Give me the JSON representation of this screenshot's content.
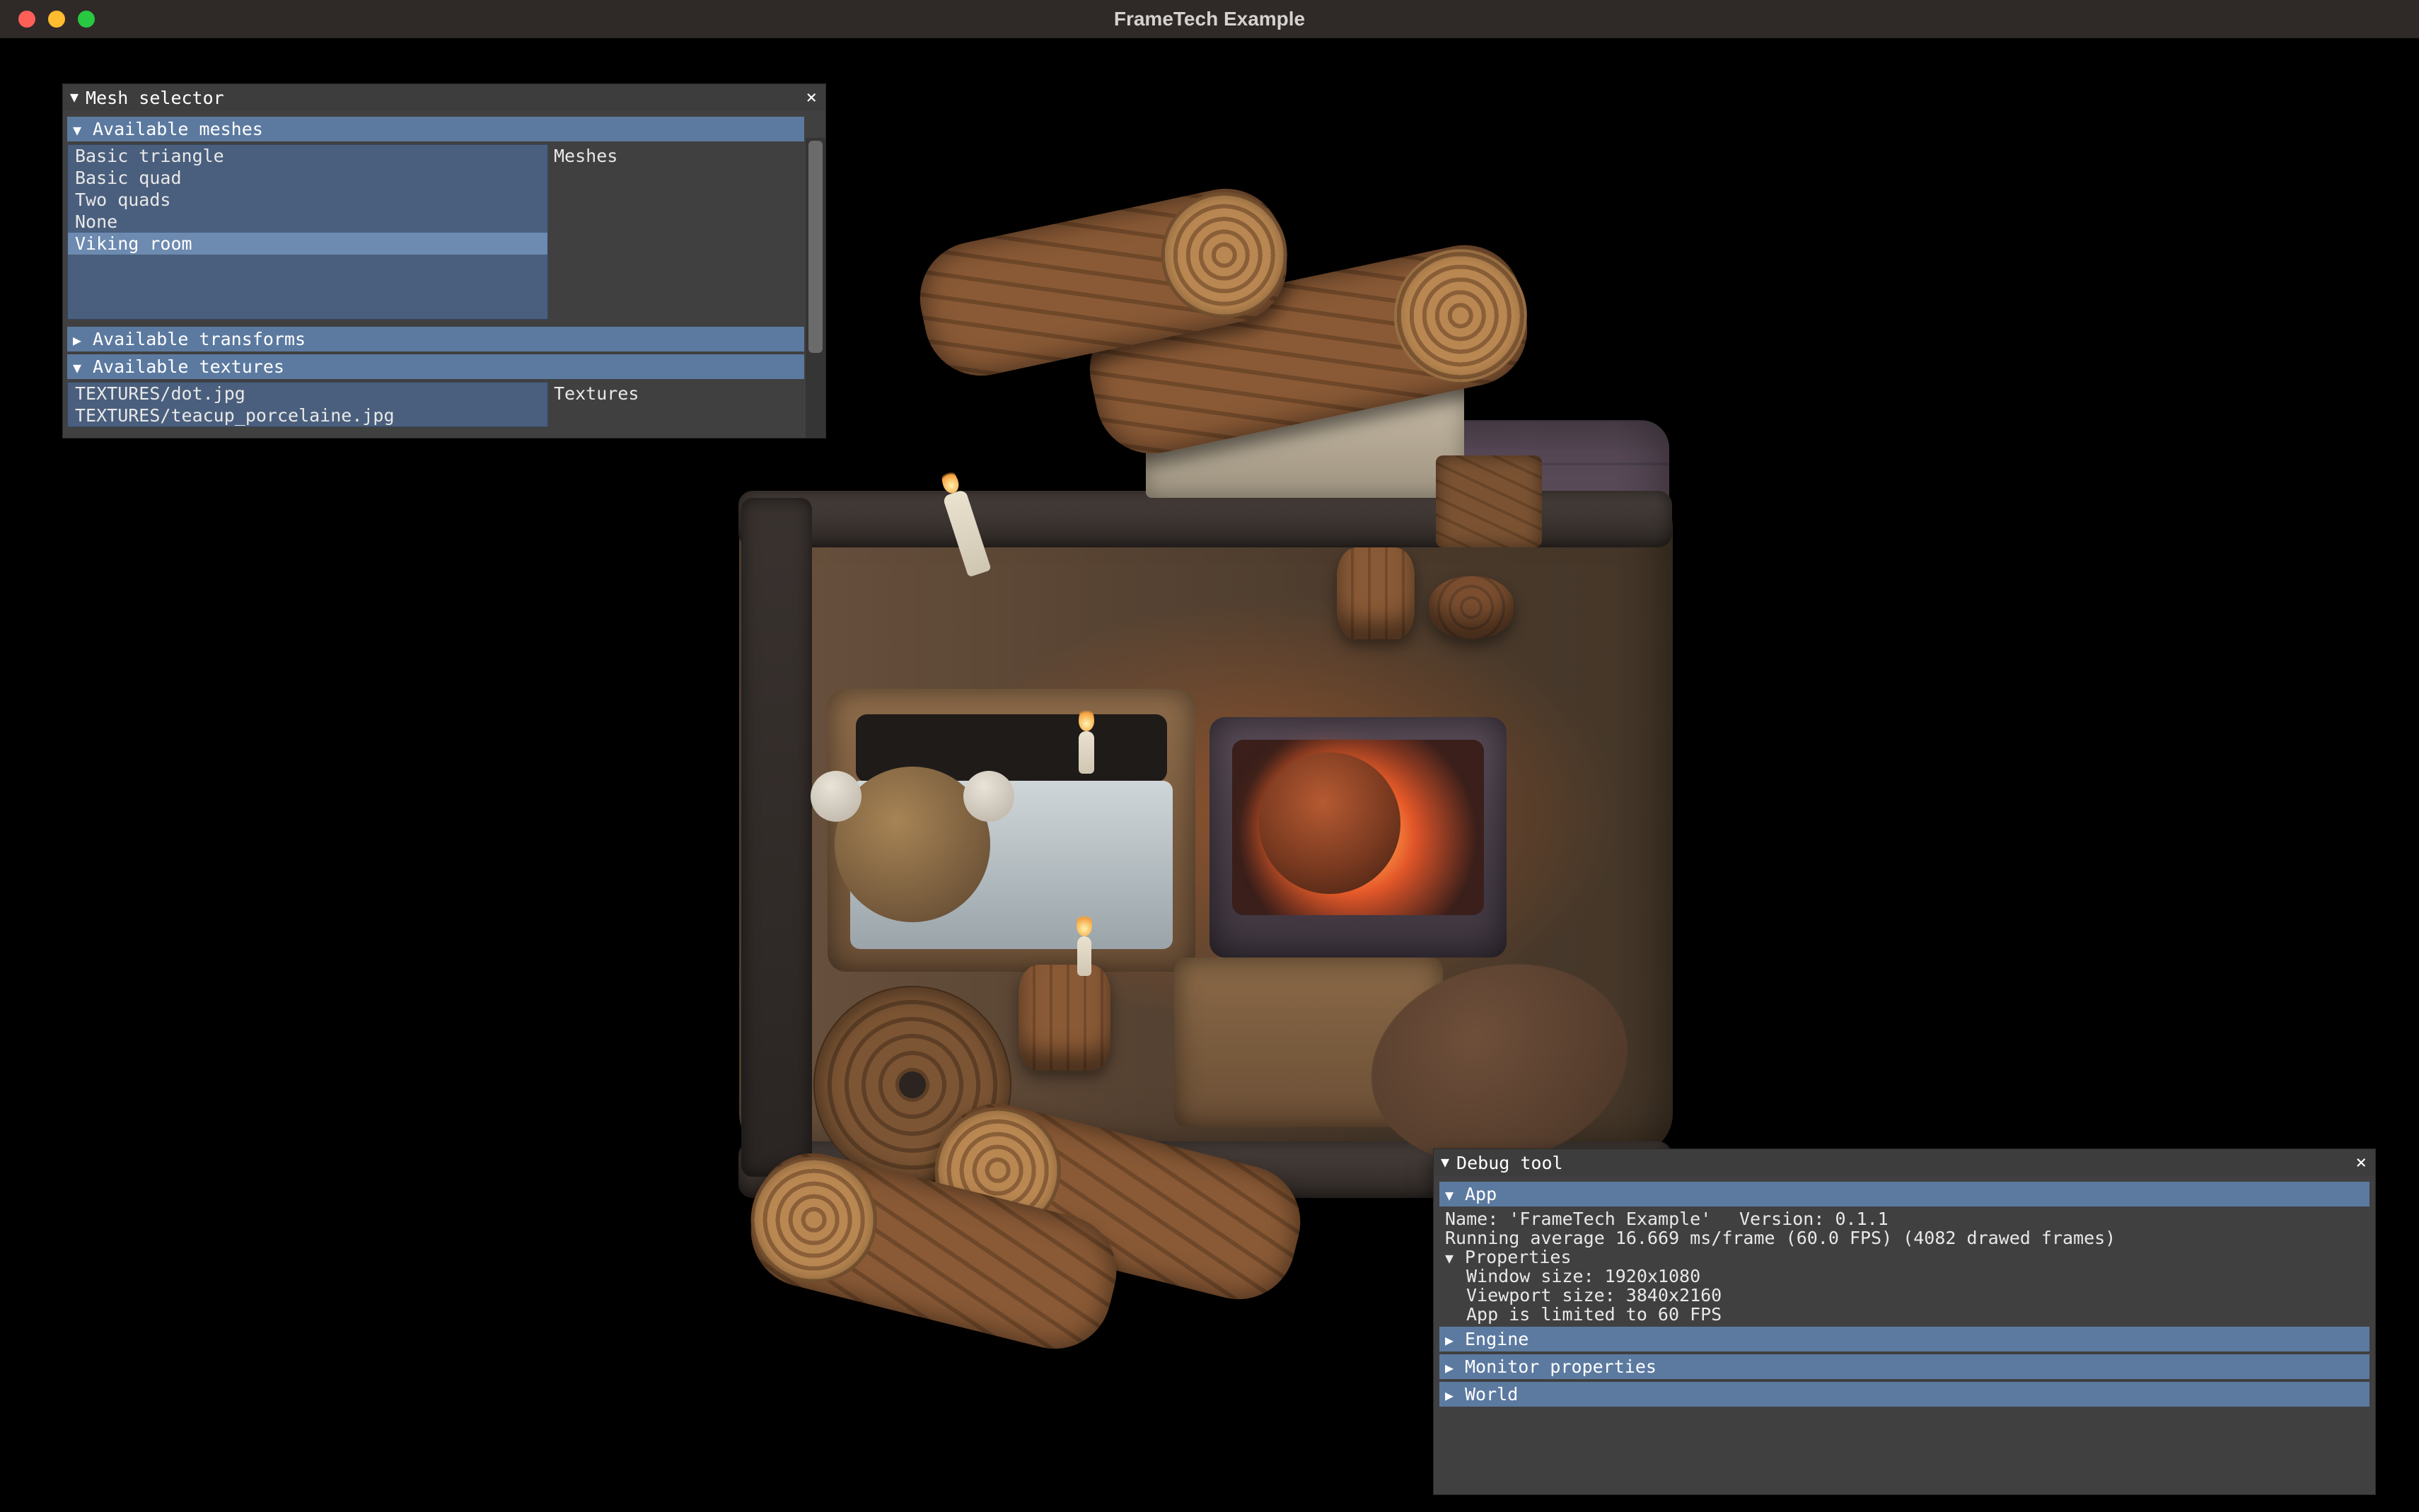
{
  "window": {
    "title": "FrameTech Example"
  },
  "mesh_selector": {
    "title": "Mesh selector",
    "sections": {
      "meshes": {
        "label": "Available meshes",
        "right_label": "Meshes"
      },
      "transforms": {
        "label": "Available transforms"
      },
      "textures": {
        "label": "Available textures",
        "right_label": "Textures"
      }
    },
    "mesh_items": [
      {
        "label": "Basic triangle",
        "selected": false
      },
      {
        "label": "Basic quad",
        "selected": false
      },
      {
        "label": "Two quads",
        "selected": false
      },
      {
        "label": "None",
        "selected": false
      },
      {
        "label": "Viking room",
        "selected": true
      }
    ],
    "texture_items": [
      {
        "label": "TEXTURES/dot.jpg"
      },
      {
        "label": "TEXTURES/teacup_porcelaine.jpg"
      }
    ]
  },
  "debug_tool": {
    "title": "Debug tool",
    "sections": {
      "app": "App",
      "engine": "Engine",
      "monitor": "Monitor properties",
      "world": "World"
    },
    "app": {
      "name_label": "Name: 'FrameTech Example'",
      "version_label": "Version: 0.1.1",
      "running_avg": "Running average 16.669 ms/frame (60.0 FPS) (4082 drawed frames)",
      "properties_label": "Properties",
      "window_size": "Window size: 1920x1080",
      "viewport_size": "Viewport size: 3840x2160",
      "fps_limit": "App is limited to 60 FPS"
    }
  }
}
